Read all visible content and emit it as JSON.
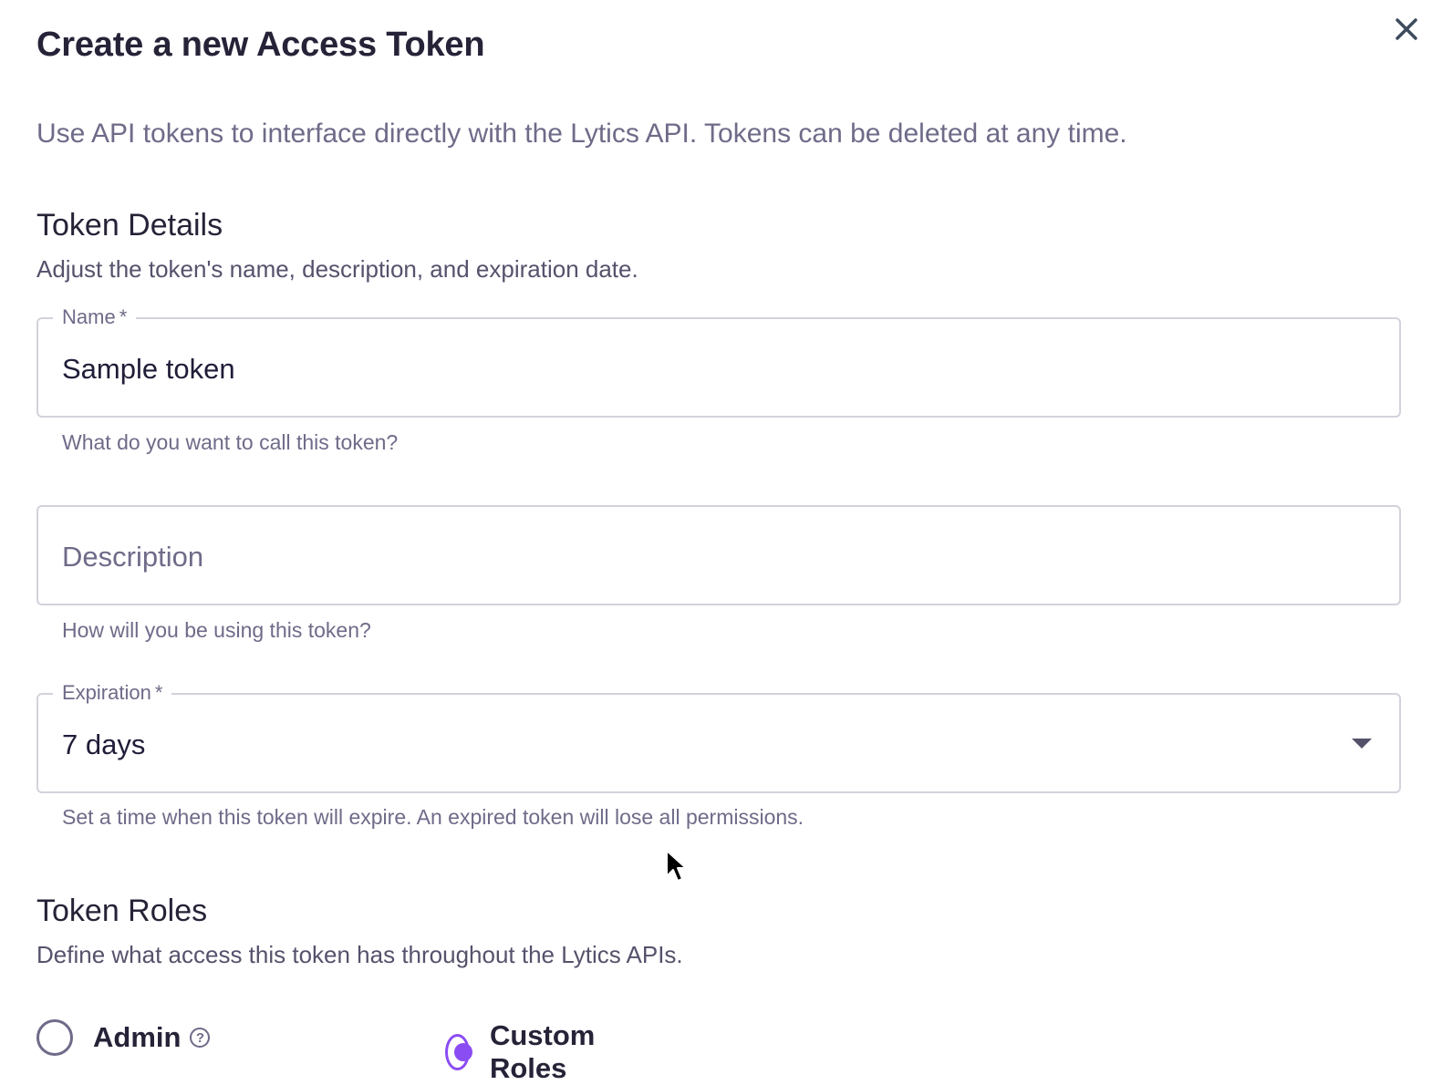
{
  "dialog": {
    "title": "Create a new Access Token",
    "intro": "Use API tokens to interface directly with the Lytics API. Tokens can be deleted at any time.",
    "close_icon": "close-icon"
  },
  "token_details": {
    "title": "Token Details",
    "description": "Adjust the token's name, description, and expiration date.",
    "name_field": {
      "label": "Name",
      "required_marker": "*",
      "value": "Sample token",
      "helper": "What do you want to call this token?"
    },
    "description_field": {
      "placeholder": "Description",
      "value": "",
      "helper": "How will you be using this token?"
    },
    "expiration_field": {
      "label": "Expiration",
      "required_marker": "*",
      "selected": "7 days",
      "helper": "Set a time when this token will expire. An expired token will lose all permissions.",
      "dropdown_icon": "caret-down-icon"
    }
  },
  "token_roles": {
    "title": "Token Roles",
    "description": "Define what access this token has throughout the Lytics APIs.",
    "options": [
      {
        "label": "Admin",
        "selected": false,
        "help_icon": "question-circle-icon",
        "help_glyph": "?"
      },
      {
        "label": "Custom Roles",
        "selected": true
      }
    ]
  },
  "colors": {
    "accent": "#8a4cf3",
    "title_text": "#262338",
    "muted_text": "#6e6b89",
    "border": "#d3d2dc"
  }
}
